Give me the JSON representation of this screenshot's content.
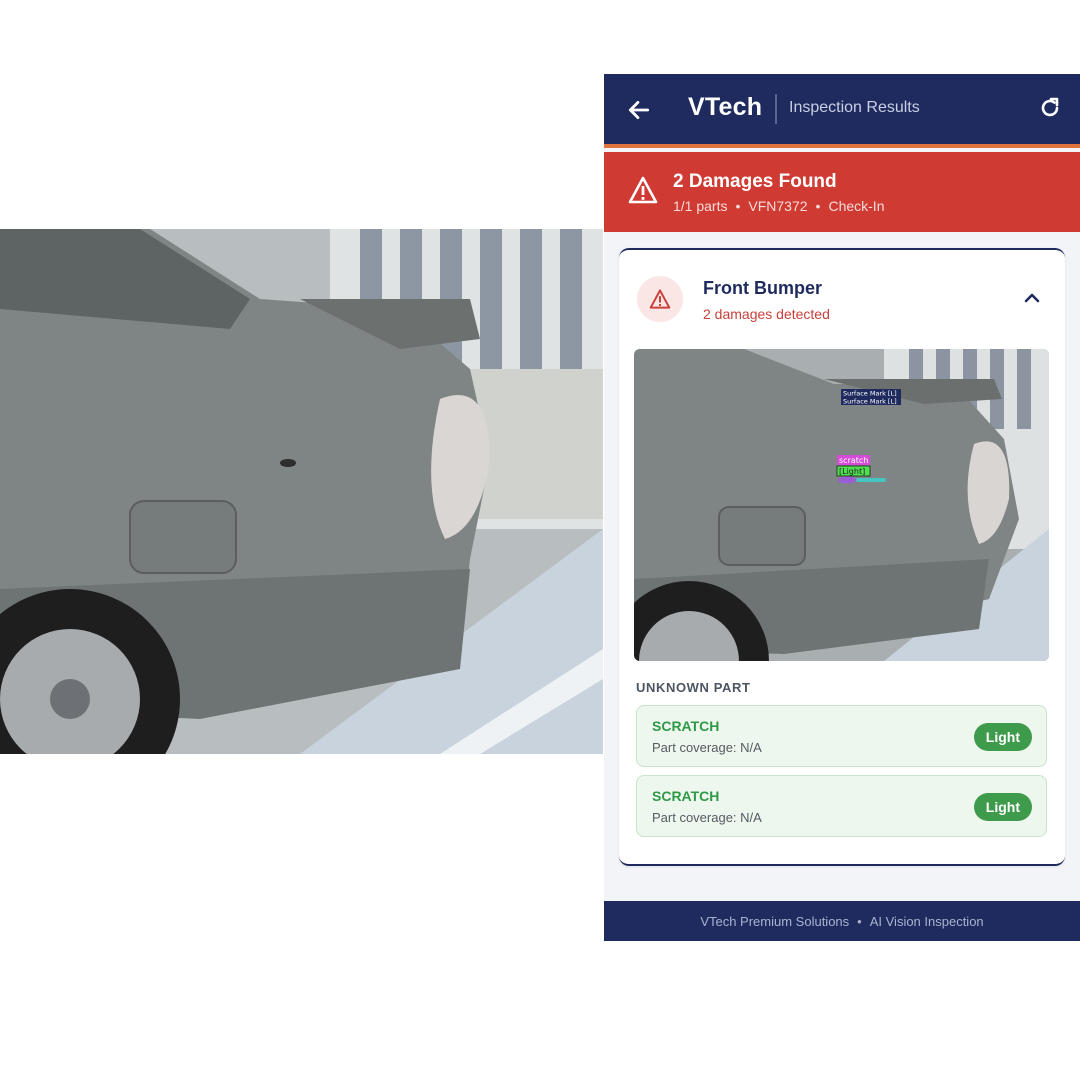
{
  "header": {
    "brand": "VTech",
    "subtitle": "Inspection Results",
    "back_icon": "arrow-left-icon",
    "refresh_icon": "refresh-icon"
  },
  "alert": {
    "title": "2 Damages Found",
    "parts": "1/1 parts",
    "plate": "VFN7372",
    "mode": "Check-In",
    "separator": "•",
    "icon": "warning-triangle-icon"
  },
  "part_card": {
    "title": "Front Bumper",
    "subtitle": "2 damages detected",
    "icon": "warning-triangle-icon",
    "toggle_icon": "chevron-up-icon",
    "detections": [
      {
        "label": "Surface Mark [L]"
      },
      {
        "label": "Surface Mark [L]"
      },
      {
        "label": "scratch"
      },
      {
        "label": "[Light]"
      }
    ],
    "section_label": "UNKNOWN PART",
    "damages": [
      {
        "type": "SCRATCH",
        "coverage": "Part coverage: N/A",
        "severity": "Light"
      },
      {
        "type": "SCRATCH",
        "coverage": "Part coverage: N/A",
        "severity": "Light"
      }
    ]
  },
  "footer": {
    "left": "VTech Premium Solutions",
    "separator": "•",
    "right": "AI Vision Inspection"
  },
  "colors": {
    "navy": "#1f2b5e",
    "alert_red": "#cf3a33",
    "accent_orange": "#e0743c",
    "success_green": "#3f9b4c"
  }
}
